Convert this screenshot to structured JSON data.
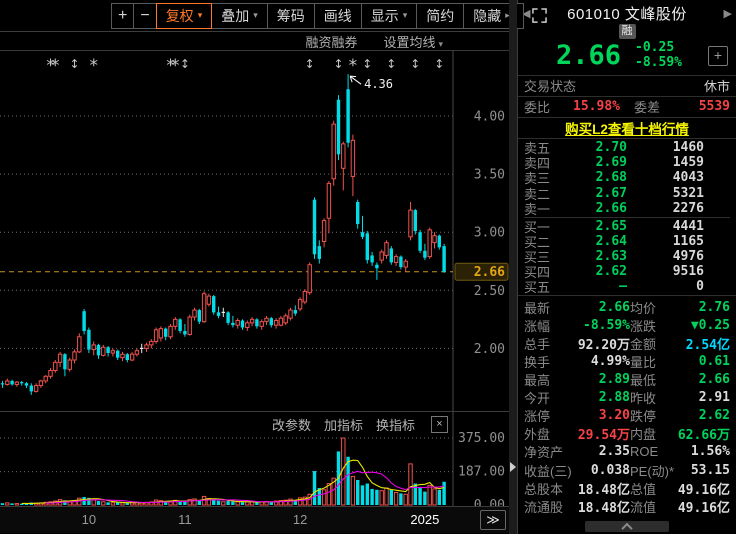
{
  "toolbar": {
    "buttons": [
      {
        "label": "+",
        "narrow": true
      },
      {
        "label": "−",
        "narrow": true
      },
      {
        "label": "复权",
        "arrow": true,
        "active": true
      },
      {
        "label": "叠加",
        "arrow": true
      },
      {
        "label": "筹码"
      },
      {
        "label": "画线"
      },
      {
        "label": "显示",
        "arrow": true
      },
      {
        "label": "简约"
      },
      {
        "label": "隐藏",
        "suffix": "▸▸"
      }
    ]
  },
  "subbar": {
    "margin_label": "融资融券",
    "ma_label": "设置均线"
  },
  "volume_toolbar": {
    "links": [
      "改参数",
      "加指标",
      "换指标"
    ],
    "close_label": "×"
  },
  "axis": {
    "next_button": "≫"
  },
  "quote": {
    "nav_prev": "◀",
    "nav_next": "▶",
    "code": "601010",
    "name": "文峰股份",
    "badge": "融",
    "price": "2.66",
    "change": "-0.25",
    "change_pct": "-8.59%",
    "add_button": "+",
    "status_label": "交易状态",
    "status_value": "休市",
    "weibi_label": "委比",
    "weibi_value": "15.98%",
    "weicha_label": "委差",
    "weicha_value": "5539",
    "l2_link": "购买L2查看十档行情",
    "asks": [
      {
        "label": "卖五",
        "price": "2.70",
        "vol": "1460"
      },
      {
        "label": "卖四",
        "price": "2.69",
        "vol": "1459"
      },
      {
        "label": "卖三",
        "price": "2.68",
        "vol": "4043"
      },
      {
        "label": "卖二",
        "price": "2.67",
        "vol": "5321"
      },
      {
        "label": "卖一",
        "price": "2.66",
        "vol": "2276"
      }
    ],
    "bids": [
      {
        "label": "买一",
        "price": "2.65",
        "vol": "4441"
      },
      {
        "label": "买二",
        "price": "2.64",
        "vol": "1165"
      },
      {
        "label": "买三",
        "price": "2.63",
        "vol": "4976"
      },
      {
        "label": "买四",
        "price": "2.62",
        "vol": "9516"
      },
      {
        "label": "买五",
        "price": "—",
        "vol": "0"
      }
    ],
    "stats": [
      {
        "l": "最新",
        "v": "2.66",
        "c": "green",
        "l2": "均价",
        "v2": "2.76",
        "c2": "green"
      },
      {
        "l": "涨幅",
        "v": "-8.59%",
        "c": "green",
        "l2": "涨跌",
        "v2": "▼0.25",
        "c2": "green"
      },
      {
        "l": "总手",
        "v": "92.20万",
        "c": "white",
        "l2": "金额",
        "v2": "2.54亿",
        "c2": "cyan"
      },
      {
        "l": "换手",
        "v": "4.99%",
        "c": "white",
        "l2": "量比",
        "v2": "0.61",
        "c2": "green"
      },
      {
        "l": "最高",
        "v": "2.89",
        "c": "green",
        "l2": "最低",
        "v2": "2.66",
        "c2": "green"
      },
      {
        "l": "今开",
        "v": "2.88",
        "c": "green",
        "l2": "昨收",
        "v2": "2.91",
        "c2": "white"
      },
      {
        "l": "涨停",
        "v": "3.20",
        "c": "red",
        "l2": "跌停",
        "v2": "2.62",
        "c2": "green"
      },
      {
        "l": "外盘",
        "v": "29.54万",
        "c": "red",
        "l2": "内盘",
        "v2": "62.66万",
        "c2": "green"
      },
      {
        "l": "净资产",
        "v": "2.35",
        "c": "white",
        "l2": "ROE",
        "v2": "1.56%",
        "c2": "white"
      },
      {
        "l": "收益(三)",
        "v": "0.038",
        "c": "white",
        "l2": "PE(动)*",
        "v2": "53.15",
        "c2": "white"
      },
      {
        "l": "总股本",
        "v": "18.48亿",
        "c": "white",
        "l2": "总值",
        "v2": "49.16亿",
        "c2": "white"
      },
      {
        "l": "流通股",
        "v": "18.48亿",
        "c": "white",
        "l2": "流值",
        "v2": "49.16亿",
        "c2": "white"
      }
    ]
  },
  "chart_data": {
    "type": "candlestick",
    "symbol": "601010",
    "colors": {
      "up": "#f0524e",
      "down": "#00dde8",
      "doji": "#e8e8e8",
      "grid": "#6e6e6e",
      "axis": "#4a4a4a",
      "last_price_line": "#c9941a",
      "last_price_text": "#e2a616",
      "ma5": "#e8e800",
      "ma10": "#e800e8",
      "event": "#c8c8c8"
    },
    "y_axis": {
      "ticks": [
        "4.00",
        "3.50",
        "3.00",
        "2.50",
        "2.00"
      ],
      "tick_values": [
        4.0,
        3.5,
        3.0,
        2.5,
        2.0
      ],
      "last_price": 2.66,
      "last_price_label": "2.66"
    },
    "volume_axis": {
      "ticks": [
        "375.00",
        "187.00",
        "0.00"
      ],
      "tick_values": [
        375,
        187,
        0
      ]
    },
    "x_axis": {
      "months": [
        {
          "label": "10",
          "index": 18
        },
        {
          "label": "11",
          "index": 38
        },
        {
          "label": "12",
          "index": 62
        },
        {
          "label": "2025",
          "index": 88,
          "highlight": true
        }
      ]
    },
    "annotation": {
      "text": "4.36",
      "index": 72,
      "price": 4.36
    },
    "events": [
      {
        "index": 10,
        "glyph": "star"
      },
      {
        "index": 11,
        "glyph": "star"
      },
      {
        "index": 15,
        "glyph": "arrows"
      },
      {
        "index": 19,
        "glyph": "star"
      },
      {
        "index": 35,
        "glyph": "star"
      },
      {
        "index": 36,
        "glyph": "star"
      },
      {
        "index": 38,
        "glyph": "arrows"
      },
      {
        "index": 64,
        "glyph": "arrows"
      },
      {
        "index": 70,
        "glyph": "arrows"
      },
      {
        "index": 73,
        "glyph": "star"
      },
      {
        "index": 76,
        "glyph": "arrows"
      },
      {
        "index": 81,
        "glyph": "arrows"
      },
      {
        "index": 86,
        "glyph": "arrows"
      },
      {
        "index": 91,
        "glyph": "arrows"
      }
    ],
    "candles": [
      [
        1.7,
        1.72,
        1.66,
        1.69,
        10
      ],
      [
        1.69,
        1.74,
        1.68,
        1.72,
        12
      ],
      [
        1.72,
        1.73,
        1.68,
        1.69,
        9
      ],
      [
        1.69,
        1.72,
        1.67,
        1.71,
        8
      ],
      [
        1.71,
        1.72,
        1.68,
        1.7,
        7
      ],
      [
        1.7,
        1.71,
        1.66,
        1.68,
        8
      ],
      [
        1.68,
        1.7,
        1.6,
        1.63,
        14
      ],
      [
        1.63,
        1.7,
        1.62,
        1.68,
        11
      ],
      [
        1.68,
        1.73,
        1.66,
        1.72,
        12
      ],
      [
        1.72,
        1.77,
        1.7,
        1.76,
        15
      ],
      [
        1.76,
        1.83,
        1.74,
        1.81,
        18
      ],
      [
        1.81,
        1.9,
        1.79,
        1.88,
        22
      ],
      [
        1.88,
        1.97,
        1.84,
        1.95,
        30
      ],
      [
        1.95,
        1.96,
        1.76,
        1.82,
        26
      ],
      [
        1.82,
        1.92,
        1.8,
        1.9,
        20
      ],
      [
        1.9,
        1.99,
        1.87,
        1.97,
        24
      ],
      [
        1.97,
        2.13,
        1.96,
        2.1,
        38
      ],
      [
        2.32,
        2.34,
        2.12,
        2.15,
        45
      ],
      [
        2.16,
        2.18,
        1.96,
        1.99,
        40
      ],
      [
        1.99,
        2.06,
        1.94,
        2.03,
        28
      ],
      [
        2.03,
        2.04,
        1.91,
        1.94,
        22
      ],
      [
        1.94,
        2.03,
        1.93,
        2.01,
        18
      ],
      [
        2.01,
        2.02,
        1.93,
        1.96,
        15
      ],
      [
        1.96,
        2.0,
        1.93,
        1.98,
        13
      ],
      [
        1.98,
        1.99,
        1.9,
        1.92,
        14
      ],
      [
        1.92,
        1.97,
        1.89,
        1.95,
        12
      ],
      [
        1.95,
        1.96,
        1.88,
        1.9,
        11
      ],
      [
        1.9,
        1.97,
        1.89,
        1.95,
        13
      ],
      [
        1.95,
        2.0,
        1.93,
        1.98,
        14
      ],
      [
        2.0,
        2.04,
        1.96,
        2.0,
        12
      ],
      [
        2.0,
        2.05,
        1.97,
        2.03,
        15
      ],
      [
        2.03,
        2.08,
        2.0,
        2.06,
        17
      ],
      [
        2.06,
        2.18,
        2.04,
        2.16,
        28
      ],
      [
        2.09,
        2.19,
        2.06,
        2.17,
        24
      ],
      [
        2.17,
        2.18,
        2.07,
        2.1,
        20
      ],
      [
        2.1,
        2.21,
        2.08,
        2.19,
        22
      ],
      [
        2.19,
        2.27,
        2.16,
        2.25,
        26
      ],
      [
        2.25,
        2.26,
        2.13,
        2.15,
        21
      ],
      [
        2.15,
        2.21,
        2.1,
        2.12,
        19
      ],
      [
        2.12,
        2.29,
        2.11,
        2.27,
        30
      ],
      [
        2.27,
        2.35,
        2.24,
        2.33,
        34
      ],
      [
        2.33,
        2.34,
        2.21,
        2.23,
        26
      ],
      [
        2.23,
        2.49,
        2.22,
        2.47,
        48
      ],
      [
        2.38,
        2.47,
        2.36,
        2.45,
        36
      ],
      [
        2.45,
        2.46,
        2.29,
        2.31,
        30
      ],
      [
        2.31,
        2.36,
        2.26,
        2.28,
        24
      ],
      [
        2.31,
        2.35,
        2.27,
        2.31,
        18
      ],
      [
        2.31,
        2.32,
        2.2,
        2.22,
        22
      ],
      [
        2.22,
        2.28,
        2.18,
        2.2,
        19
      ],
      [
        2.2,
        2.26,
        2.17,
        2.24,
        18
      ],
      [
        2.24,
        2.25,
        2.16,
        2.18,
        16
      ],
      [
        2.18,
        2.24,
        2.15,
        2.22,
        17
      ],
      [
        2.22,
        2.27,
        2.19,
        2.25,
        19
      ],
      [
        2.25,
        2.26,
        2.17,
        2.19,
        15
      ],
      [
        2.19,
        2.25,
        2.16,
        2.23,
        17
      ],
      [
        2.23,
        2.28,
        2.2,
        2.26,
        20
      ],
      [
        2.26,
        2.27,
        2.18,
        2.2,
        16
      ],
      [
        2.2,
        2.26,
        2.17,
        2.24,
        22
      ],
      [
        2.2,
        2.28,
        2.19,
        2.26,
        25
      ],
      [
        2.22,
        2.3,
        2.2,
        2.28,
        27
      ],
      [
        2.26,
        2.35,
        2.24,
        2.33,
        33
      ],
      [
        2.33,
        2.37,
        2.28,
        2.3,
        28
      ],
      [
        2.34,
        2.44,
        2.32,
        2.42,
        40
      ],
      [
        2.4,
        2.51,
        2.38,
        2.49,
        44
      ],
      [
        2.48,
        2.74,
        2.46,
        2.72,
        60
      ],
      [
        3.28,
        3.3,
        2.77,
        2.81,
        190
      ],
      [
        2.88,
        2.93,
        2.73,
        2.77,
        95
      ],
      [
        2.92,
        3.12,
        2.87,
        3.1,
        85
      ],
      [
        3.12,
        3.44,
        2.99,
        3.42,
        120
      ],
      [
        3.46,
        3.96,
        3.4,
        3.93,
        150
      ],
      [
        4.14,
        4.18,
        3.62,
        3.67,
        300
      ],
      [
        3.55,
        3.78,
        3.36,
        3.76,
        375
      ],
      [
        4.23,
        4.36,
        3.73,
        3.77,
        270
      ],
      [
        3.48,
        3.84,
        3.31,
        3.79,
        160
      ],
      [
        3.26,
        3.28,
        3.03,
        3.07,
        140
      ],
      [
        3.0,
        3.14,
        2.94,
        2.96,
        110
      ],
      [
        2.99,
        3.01,
        2.73,
        2.76,
        120
      ],
      [
        2.8,
        2.83,
        2.71,
        2.74,
        90
      ],
      [
        2.72,
        2.74,
        2.59,
        2.69,
        85
      ],
      [
        2.76,
        2.85,
        2.73,
        2.83,
        80
      ],
      [
        2.8,
        2.93,
        2.77,
        2.91,
        95
      ],
      [
        2.86,
        2.88,
        2.72,
        2.74,
        85
      ],
      [
        2.74,
        2.81,
        2.71,
        2.79,
        70
      ],
      [
        2.79,
        2.8,
        2.68,
        2.7,
        65
      ],
      [
        2.7,
        2.77,
        2.66,
        2.75,
        60
      ],
      [
        2.96,
        3.26,
        2.93,
        3.19,
        230
      ],
      [
        3.19,
        3.2,
        2.98,
        3.01,
        120
      ],
      [
        3.0,
        3.02,
        2.82,
        2.84,
        95
      ],
      [
        2.84,
        2.9,
        2.76,
        2.78,
        75
      ],
      [
        2.79,
        3.04,
        2.77,
        3.02,
        110
      ],
      [
        2.91,
        3.0,
        2.86,
        2.97,
        90
      ],
      [
        2.97,
        2.98,
        2.85,
        2.87,
        85
      ],
      [
        2.88,
        2.9,
        2.65,
        2.66,
        130
      ]
    ]
  }
}
